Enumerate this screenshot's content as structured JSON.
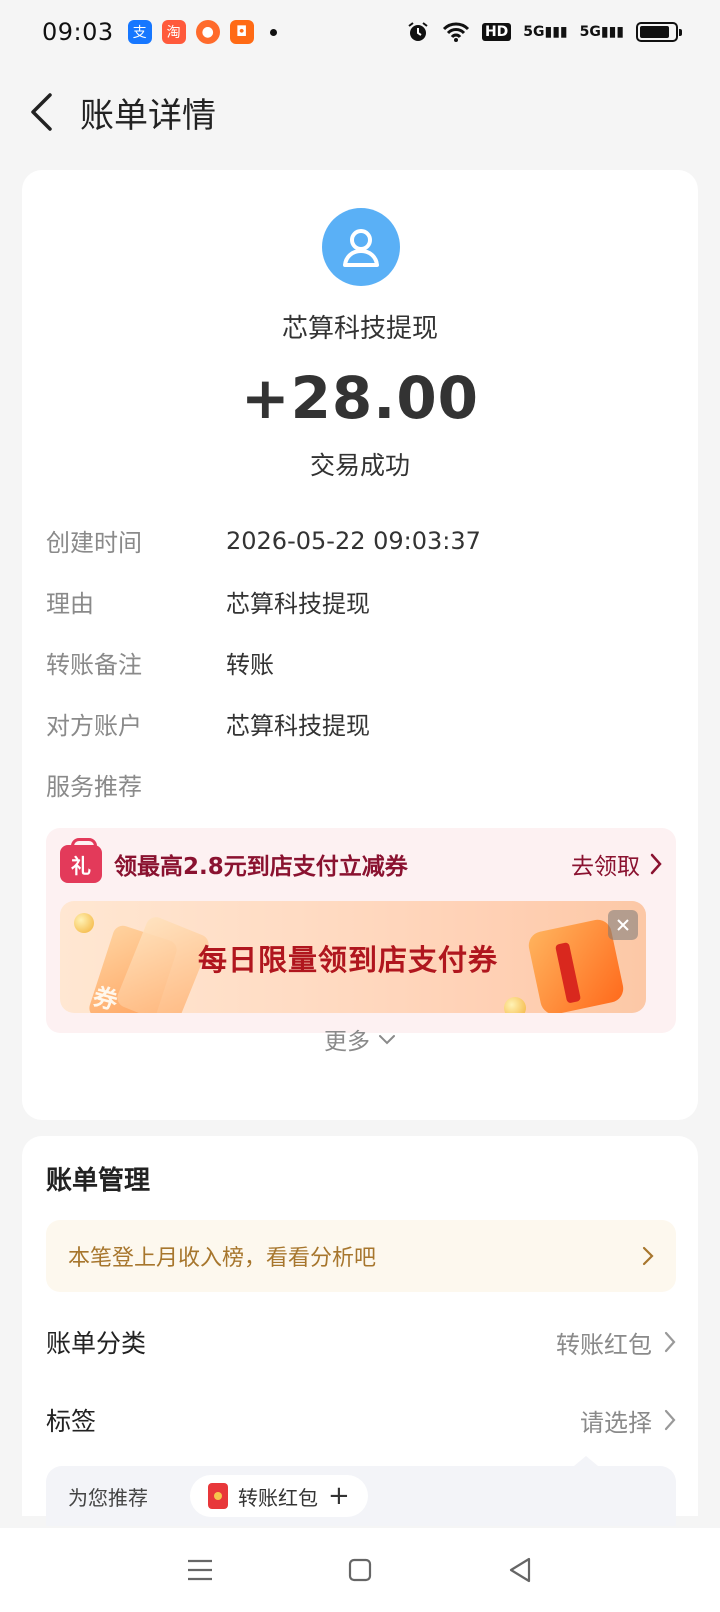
{
  "status_bar": {
    "time": "09:03",
    "apps": [
      {
        "name": "alipay-app-icon",
        "glyph": "支",
        "color": "#1677ff"
      },
      {
        "name": "taobao-app-icon",
        "glyph": "淘",
        "color": "#ff5a3c"
      },
      {
        "name": "game-app-icon",
        "glyph": "●",
        "color": "#ff6b2c"
      },
      {
        "name": "redpacket-app-icon",
        "glyph": "◘",
        "color": "#ff6a14"
      }
    ],
    "hd_label": "HD",
    "net1": "5G",
    "net2": "5G",
    "battery_level": 0.85
  },
  "header": {
    "title": "账单详情"
  },
  "transaction": {
    "payee": "芯算科技提现",
    "amount": "+28.00",
    "status": "交易成功",
    "details": [
      {
        "label": "创建时间",
        "value": "2026-05-22 09:03:37"
      },
      {
        "label": "理由",
        "value": "芯算科技提现"
      },
      {
        "label": "转账备注",
        "value": "转账"
      },
      {
        "label": "对方账户",
        "value": "芯算科技提现"
      },
      {
        "label": "服务推荐",
        "value": ""
      }
    ]
  },
  "promo": {
    "gift_glyph": "礼",
    "title": "领最高2.8元到店支付立减券",
    "action": "去领取",
    "banner_text": "每日限量领到店支付券",
    "ticket_glyph": "券"
  },
  "more": {
    "label": "更多"
  },
  "management": {
    "title": "账单管理",
    "tip": "本笔登上月收入榜，看看分析吧",
    "category_label": "账单分类",
    "category_value": "转账红包",
    "tag_label": "标签",
    "tag_value": "请选择",
    "recommend_label": "为您推荐",
    "recommend_chip": "转账红包",
    "recommend_plus": "+"
  },
  "colors": {
    "accent_dark_red": "#8a1230",
    "avatar_blue": "#5ab0f6",
    "tip_gold": "#a7762d"
  }
}
